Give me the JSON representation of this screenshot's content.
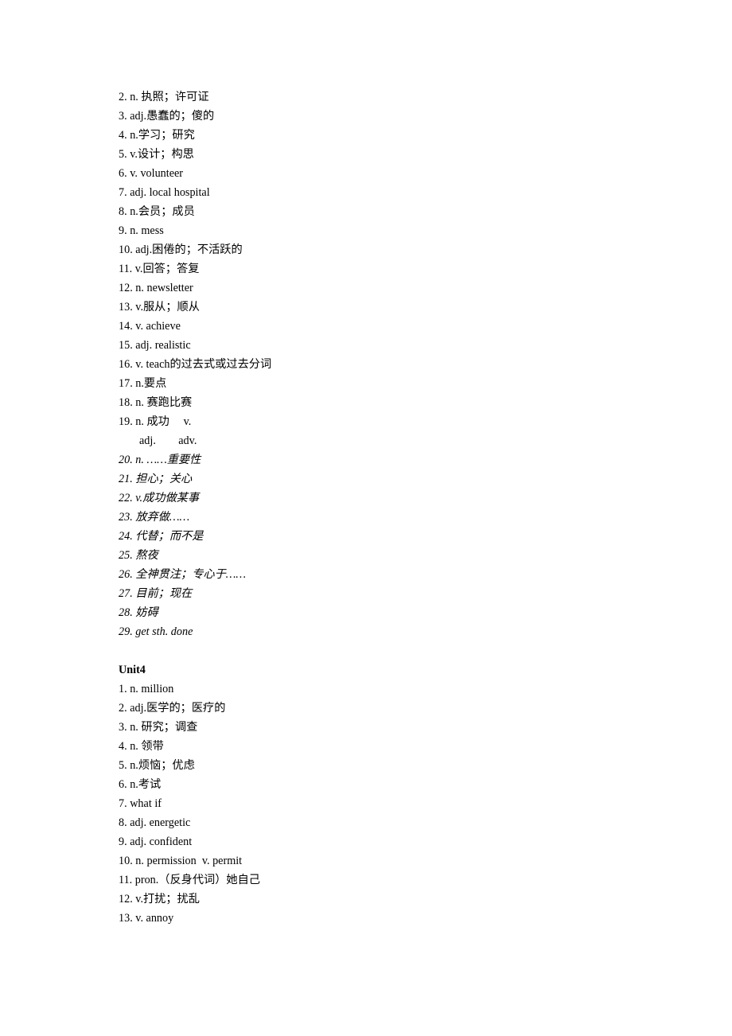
{
  "listA": [
    "2. n. 执照；许可证",
    "3. adj.愚蠢的；傻的",
    "4. n.学习；研究",
    "5. v.设计；构思",
    "6. v. volunteer",
    "7. adj. local hospital",
    "8. n.会员；成员",
    "9. n. mess",
    "10. adj.困倦的；不活跃的",
    "11. v.回答；答复",
    "12. n. newsletter",
    "13. v.服从；顺从",
    "14. v. achieve",
    "15. adj. realistic",
    "16. v. teach的过去式或过去分词",
    "17. n.要点",
    "18. n. 赛跑比赛"
  ],
  "line19a": "19. n. 成功     v.",
  "line19b": "adj.        adv.",
  "italicList": [
    "20. n. ……重要性",
    "21. 担心；关心",
    "22. v.成功做某事",
    "23. 放弃做……",
    "24. 代替；而不是",
    "25. 熬夜",
    "26. 全神贯注；专心于……",
    "27. 目前；现在",
    "28. 妨碍",
    "29. get sth. done"
  ],
  "unitTitle": "Unit4",
  "listB": [
    "1. n. million",
    "2. adj.医学的；医疗的",
    "3. n. 研究；调查",
    "4. n. 领带",
    "5. n.烦恼；优虑",
    "6. n.考试",
    "7. what if",
    "8. adj. energetic",
    "9. adj. confident",
    "10. n. permission  v. permit",
    "11. pron.（反身代词）她自己",
    "12. v.打扰；扰乱",
    "13. v. annoy"
  ]
}
